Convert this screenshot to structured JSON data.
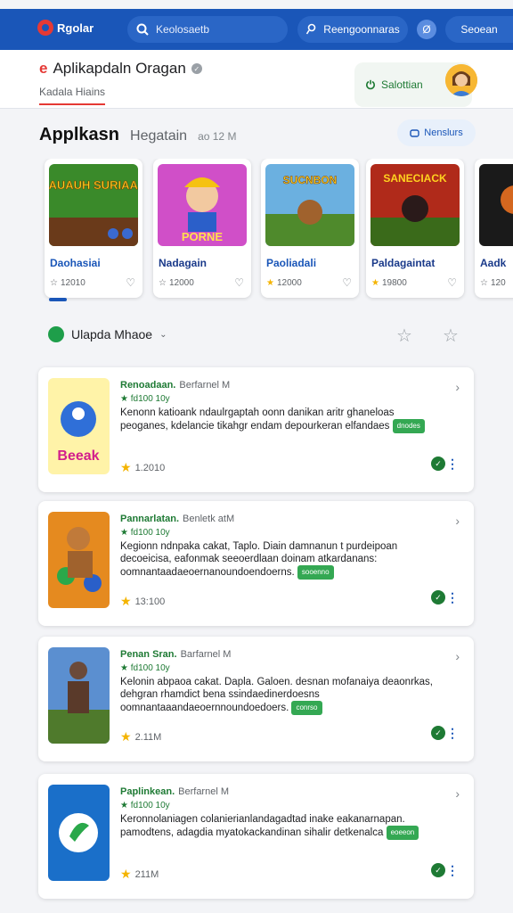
{
  "topbar": {
    "logo": "Rgolar",
    "search_placeholder": "Keolosaetb",
    "account_label": "Reengoonnaras",
    "account_icon": "Ø",
    "action_label": "Seoean"
  },
  "header": {
    "app_title": "Aplikapdaln Oragan",
    "subtab": "Kadala Hiains",
    "signin_label": "Salottian"
  },
  "section": {
    "title": "Applkasn",
    "subtitle": "Hegatain",
    "count": "ao 12 M",
    "chip_label": "Nenslurs"
  },
  "games": [
    {
      "name": "Daohasiai",
      "rating": "12010",
      "art": "SAUAUH SURIAAN"
    },
    {
      "name": "Nadagain",
      "rating": "12000",
      "art": "PORNE"
    },
    {
      "name": "Paoliadali",
      "rating": "12000",
      "art": "SUCNBON"
    },
    {
      "name": "Paldagaintat",
      "rating": "19800",
      "art": "SANECIACK"
    },
    {
      "name": "Aadk",
      "rating": "120",
      "art": ""
    }
  ],
  "filter": {
    "label": "Ulapda Mhaoe"
  },
  "apps": [
    {
      "title": "Renoadaan.",
      "dev": "Berfarnel M",
      "rating": "★ fd100 10y",
      "desc": "Kenonn katioank ndaulrgaptah oonn danikan aritr ghaneloas peoganes, kdelancie tikahgr endam depourkeran elfandaes",
      "tag": "dnodes",
      "downloads": "1.2010"
    },
    {
      "title": "Pannarlatan.",
      "dev": "Benletk atM",
      "rating": "★ fd100 10y",
      "desc": "Kegionn ndnpaka cakat, Taplo. Diain damnanun t purdeipoan decoeicisa, eafonmak seeoerdlaan doinam atkardanans: oomnantaadaeoernanoundoendoerns.",
      "tag": "sooenno",
      "downloads": "13:100"
    },
    {
      "title": "Penan Sran.",
      "dev": "Barfarnel M",
      "rating": "★ fd100 10y",
      "desc": "Kelonin abpaoa cakat. Dapla. Galoen. desnan mofanaiya deaonrkas, dehgran rhamdict bena ssindaedinerdoesns oomnantaaandaeoernnoundoedoers.",
      "tag": "conrso",
      "downloads": "2.11M"
    },
    {
      "title": "Paplinkean.",
      "dev": "Berfarnel M",
      "rating": "★ fd100 10y",
      "desc": "Keronnolaniagen colanierianlandagadtad inake eakanarnapan. pamodtens, adagdia myatokackandinan sihalir detkenalca",
      "tag": "eoeeon",
      "downloads": "211M"
    }
  ],
  "colors": {
    "accent": "#1a56b8",
    "brand_red": "#e53935",
    "green": "#1e7a34"
  }
}
